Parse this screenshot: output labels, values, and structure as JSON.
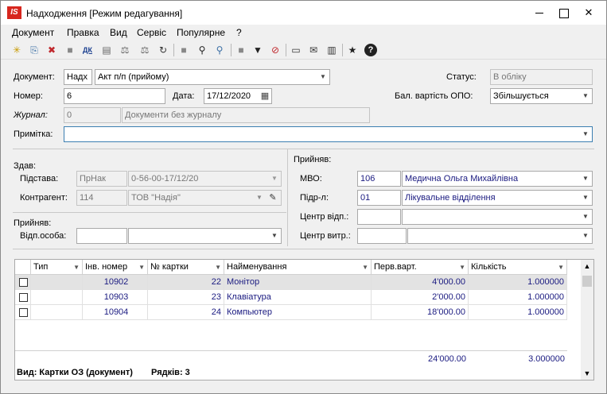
{
  "window": {
    "app_icon": "IS",
    "title": "Надходження [Режим редагування]"
  },
  "menu": [
    "Документ",
    "Правка",
    "Вид",
    "Сервіс",
    "Популярне",
    "?"
  ],
  "toolbar": {
    "icons": [
      "new-doc-icon",
      "new-copy-icon",
      "delete-doc-icon",
      "grey-icon",
      "dk-icon",
      "tax-icon",
      "balance-icon",
      "balance-down-icon",
      "refresh-icon",
      "stop-icon",
      "find-icon",
      "find-next-icon",
      "grey-square-icon",
      "filter-icon",
      "clear-filter-icon",
      "document-icon",
      "mail-icon",
      "columns-icon",
      "star-icon",
      "help-icon"
    ],
    "dk_label": "ДК"
  },
  "form": {
    "document_label": "Документ:",
    "document_code": "Надх",
    "document_type": "Акт п/п (прийому)",
    "status_label": "Статус:",
    "status_value": "В обліку",
    "number_label": "Номер:",
    "number_value": "6",
    "date_label": "Дата:",
    "date_value": "17/12/2020",
    "opo_label": "Бал. вартість ОПО:",
    "opo_value": "Збільшується",
    "journal_label": "Журнал:",
    "journal_code": "0",
    "journal_name": "Документи без журналу",
    "note_label": "Примітка:",
    "note_value": ""
  },
  "zdav": {
    "section_label": "Здав:",
    "basis_label": "Підстава:",
    "basis_code": "ПрНак",
    "basis_value": "0-56-00-17/12/20",
    "counterparty_label": "Контрагент:",
    "counterparty_code": "114",
    "counterparty_name": "ТОВ \"Надія\""
  },
  "pryiniav_left": {
    "section_label": "Прийняв:",
    "person_label": "Відп.особа:",
    "person_code": "",
    "person_name": ""
  },
  "pryiniav_right": {
    "section_label": "Прийняв:",
    "mvo_label": "МВО:",
    "mvo_code": "106",
    "mvo_name": "Медична Ольга Михайлівна",
    "dept_label": "Підр-л:",
    "dept_code": "01",
    "dept_name": "Лікувальне відділення",
    "resp_center_label": "Центр відп.:",
    "resp_center_code": "",
    "resp_center_name": "",
    "cost_center_label": "Центр витр.:",
    "cost_center_code": "",
    "cost_center_name": ""
  },
  "table": {
    "columns": [
      "Тип",
      "Інв. номер",
      "№ картки",
      "Найменування",
      "Перв.варт.",
      "Кількість"
    ],
    "rows": [
      {
        "inv": "10902",
        "card": "22",
        "name": "Монітор",
        "cost": "4'000.00",
        "qty": "1.000000"
      },
      {
        "inv": "10903",
        "card": "23",
        "name": "Клавіатура",
        "cost": "2'000.00",
        "qty": "1.000000"
      },
      {
        "inv": "10904",
        "card": "24",
        "name": "Компьютер",
        "cost": "18'000.00",
        "qty": "1.000000"
      }
    ],
    "total_cost": "24'000.00",
    "total_qty": "3.000000",
    "view_label": "Вид: Картки ОЗ (документ)",
    "rows_label": "Рядків: 3"
  }
}
